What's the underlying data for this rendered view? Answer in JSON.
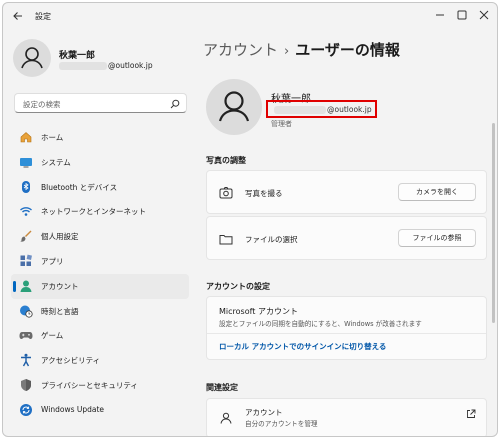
{
  "window": {
    "title": "設定"
  },
  "profile": {
    "name": "秋葉一郎",
    "email_suffix": "@outlook.jp"
  },
  "search": {
    "placeholder": "設定の検索"
  },
  "nav": [
    {
      "label": "ホーム",
      "icon": "home-icon"
    },
    {
      "label": "システム",
      "icon": "system-icon"
    },
    {
      "label": "Bluetooth とデバイス",
      "icon": "bluetooth-icon"
    },
    {
      "label": "ネットワークとインターネット",
      "icon": "wifi-icon"
    },
    {
      "label": "個人用設定",
      "icon": "brush-icon"
    },
    {
      "label": "アプリ",
      "icon": "apps-icon"
    },
    {
      "label": "アカウント",
      "icon": "account-icon",
      "active": true
    },
    {
      "label": "時刻と言語",
      "icon": "globe-clock-icon"
    },
    {
      "label": "ゲーム",
      "icon": "gamepad-icon"
    },
    {
      "label": "アクセシビリティ",
      "icon": "accessibility-icon"
    },
    {
      "label": "プライバシーとセキュリティ",
      "icon": "shield-icon"
    },
    {
      "label": "Windows Update",
      "icon": "update-icon"
    }
  ],
  "breadcrumb": {
    "parent": "アカウント",
    "separator": "›",
    "current": "ユーザーの情報"
  },
  "account": {
    "name": "秋葉一郎",
    "email_suffix": "@outlook.jp",
    "role": "管理者"
  },
  "photo_section": {
    "title": "写真の調整",
    "take_photo": {
      "label": "写真を撮る",
      "button": "カメラを開く"
    },
    "choose_file": {
      "label": "ファイルの選択",
      "button": "ファイルの参照"
    }
  },
  "account_settings": {
    "title": "アカウントの設定",
    "ms_title": "Microsoft アカウント",
    "ms_desc": "設定とファイルの同期を自動的にすると、Windows が改善されます",
    "link": "ローカル アカウントでのサインインに切り替える"
  },
  "related": {
    "title": "関連設定",
    "item_title": "アカウント",
    "item_desc": "自分のアカウントを管理"
  },
  "colors": {
    "accent": "#0067c0",
    "highlight": "#e00000"
  }
}
